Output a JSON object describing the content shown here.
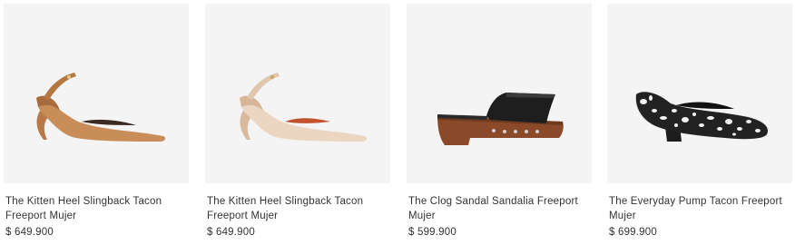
{
  "products": [
    {
      "name": "The Kitten Heel Slingback Tacon Freeport Mujer",
      "price": "$ 649.900",
      "icon": "tan-slingback-heel-image",
      "color": "#c98d5a"
    },
    {
      "name": "The Kitten Heel Slingback Tacon Freeport Mujer",
      "price": "$ 649.900",
      "icon": "beige-slingback-heel-image",
      "color": "#ecd6c2"
    },
    {
      "name": "The Clog Sandal Sandalia Freeport Mujer",
      "price": "$ 599.900",
      "icon": "black-clog-sandal-image",
      "color": "#1e1e1e"
    },
    {
      "name": "The Everyday Pump Tacon Freeport Mujer",
      "price": "$ 699.900",
      "icon": "cow-print-pump-image",
      "color": "#222222"
    }
  ]
}
